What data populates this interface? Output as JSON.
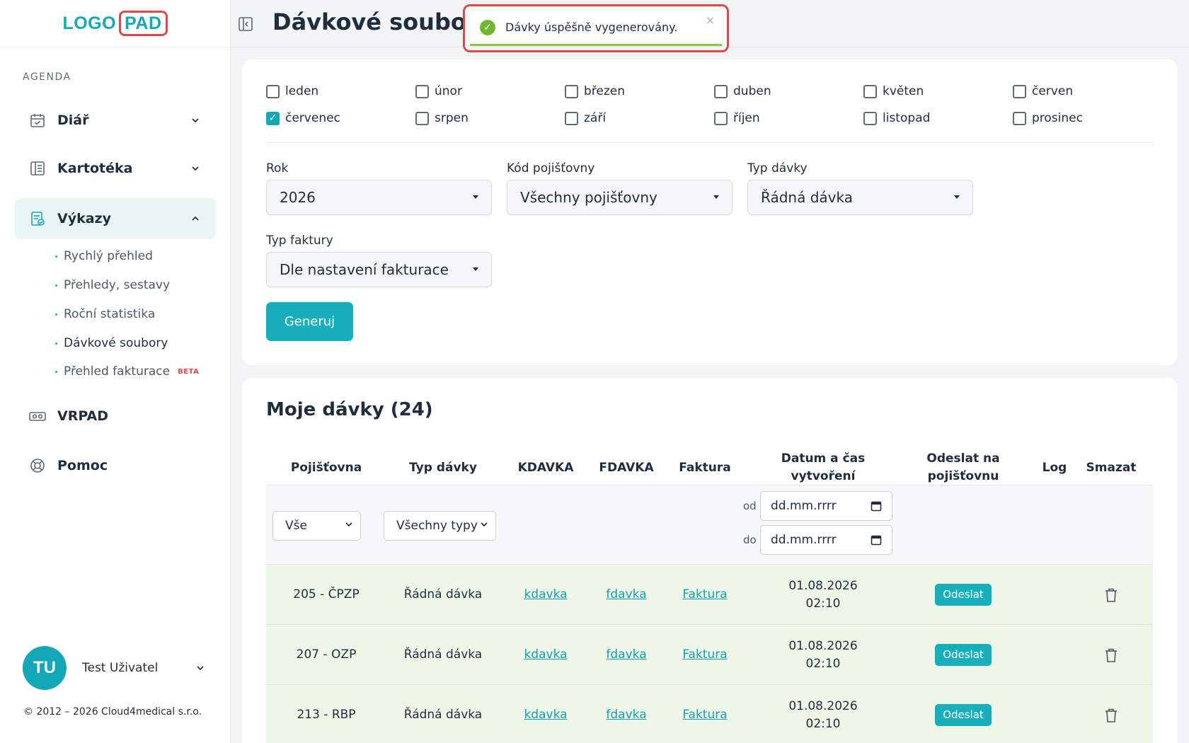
{
  "logo": {
    "left": "LOGO",
    "right": "PAD"
  },
  "sidebar": {
    "section": "AGENDA",
    "items": [
      {
        "label": "Diář",
        "icon": "calendar-check-icon"
      },
      {
        "label": "Kartotéka",
        "icon": "card-index-icon"
      },
      {
        "label": "Výkazy",
        "icon": "report-icon"
      },
      {
        "label": "VRPAD",
        "icon": "vr-headset-icon"
      },
      {
        "label": "Pomoc",
        "icon": "lifebuoy-icon"
      }
    ],
    "subitems": [
      "Rychlý přehled",
      "Přehledy, sestavy",
      "Roční statistika",
      "Dávkové soubory",
      "Přehled fakturace"
    ],
    "beta": "BETA",
    "user": {
      "initials": "TU",
      "name": "Test Uživatel"
    },
    "copyright": "© 2012 – 2026 Cloud4medical s.r.o."
  },
  "header": {
    "title": "Dávkové soubory"
  },
  "toast": {
    "message": "Dávky úspěšně vygenerovány.",
    "close": "×",
    "check": "✓"
  },
  "months": [
    {
      "label": "leden",
      "checked": false
    },
    {
      "label": "únor",
      "checked": false
    },
    {
      "label": "březen",
      "checked": false
    },
    {
      "label": "duben",
      "checked": false
    },
    {
      "label": "květen",
      "checked": false
    },
    {
      "label": "červen",
      "checked": false
    },
    {
      "label": "červenec",
      "checked": true
    },
    {
      "label": "srpen",
      "checked": false
    },
    {
      "label": "září",
      "checked": false
    },
    {
      "label": "říjen",
      "checked": false
    },
    {
      "label": "listopad",
      "checked": false
    },
    {
      "label": "prosinec",
      "checked": false
    }
  ],
  "checkmark": "✓",
  "form": {
    "year": {
      "label": "Rok",
      "value": "2026"
    },
    "insurer": {
      "label": "Kód pojišťovny",
      "value": "Všechny pojišťovny"
    },
    "batchType": {
      "label": "Typ dávky",
      "value": "Řádná dávka"
    },
    "invoiceType": {
      "label": "Typ faktury",
      "value": "Dle nastavení fakturace"
    },
    "generate": "Generuj"
  },
  "table": {
    "title": "Moje dávky (24)",
    "headers": {
      "insurer": "Pojišťovna",
      "type": "Typ dávky",
      "kdavka": "KDAVKA",
      "fdavka": "FDAVKA",
      "invoice": "Faktura",
      "created": "Datum a čas\nvytvoření",
      "send": "Odeslat na\npojišťovnu",
      "log": "Log",
      "delete": "Smazat"
    },
    "filters": {
      "insurer": "Vše",
      "type": "Všechny typy",
      "from": "od",
      "to": "do",
      "datePlaceholder": "dd.mm.rrrr"
    },
    "rows": [
      {
        "insurer": "205 - ČPZP",
        "type": "Řádná dávka",
        "kdavka": "kdavka",
        "fdavka": "fdavka",
        "invoice": "Faktura",
        "date": "01.08.2026",
        "time": "02:10",
        "send": "Odeslat"
      },
      {
        "insurer": "207 - OZP",
        "type": "Řádná dávka",
        "kdavka": "kdavka",
        "fdavka": "fdavka",
        "invoice": "Faktura",
        "date": "01.08.2026",
        "time": "02:10",
        "send": "Odeslat"
      },
      {
        "insurer": "213 - RBP",
        "type": "Řádná dávka",
        "kdavka": "kdavka",
        "fdavka": "fdavka",
        "invoice": "Faktura",
        "date": "01.08.2026",
        "time": "02:10",
        "send": "Odeslat"
      }
    ]
  },
  "colors": {
    "accent": "#18afbd",
    "highlight": "#e0484c",
    "success": "#73b62f",
    "rowBg": "#eef6e7"
  }
}
